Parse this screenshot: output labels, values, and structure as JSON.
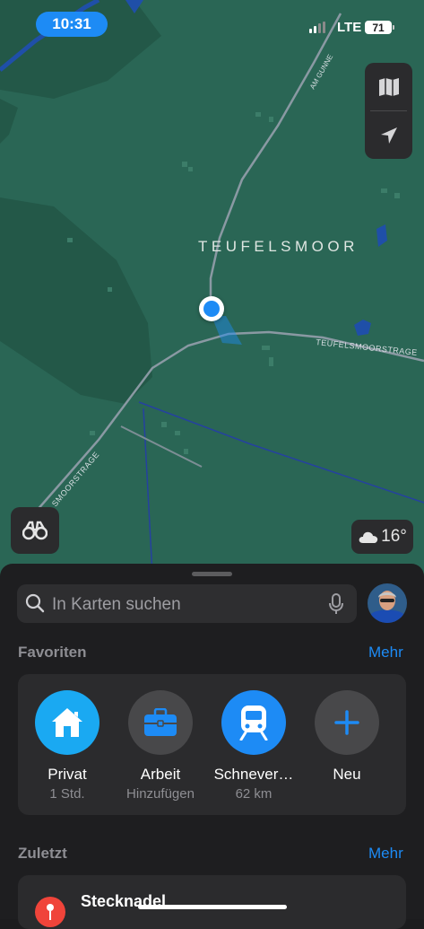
{
  "status_bar": {
    "time": "10:31",
    "network": "LTE",
    "battery": "71"
  },
  "map": {
    "place_label": "TEUFELSMOOR",
    "road_labels": {
      "am_gunne": "AM GUNNE",
      "teufelsmoorstrasse_east": "TEUFELSMOORSTRAGE",
      "teufelsmoorstrasse_west": "SMOORSTRAGE"
    },
    "temperature": "16°",
    "colors": {
      "land": "#2a6655",
      "forest": "#235848",
      "water": "#1f4fa8",
      "road": "#8a99a3",
      "user_location": "#1d8bf5"
    }
  },
  "map_controls": {
    "map_mode_icon": "map-icon",
    "locate_icon": "location-arrow-icon",
    "look_around_icon": "binoculars-icon",
    "weather_icon": "cloud-icon"
  },
  "search": {
    "placeholder": "In Karten suchen"
  },
  "favorites": {
    "title": "Favoriten",
    "more": "Mehr",
    "items": [
      {
        "label": "Privat",
        "sub": "1 Std.",
        "icon": "house-icon",
        "color": "#1aa9f2"
      },
      {
        "label": "Arbeit",
        "sub": "Hinzufügen",
        "icon": "briefcase-icon",
        "color": "#48484a"
      },
      {
        "label": "Schnever…",
        "sub": "62 km",
        "icon": "train-icon",
        "color": "#1d8bf5"
      },
      {
        "label": "Neu",
        "sub": "",
        "icon": "plus-icon",
        "color": "#48484a"
      }
    ]
  },
  "recents": {
    "title": "Zuletzt",
    "more": "Mehr",
    "items": [
      {
        "title": "Stecknadel",
        "icon": "pin-icon"
      }
    ]
  },
  "accent": "#1d8bf5"
}
